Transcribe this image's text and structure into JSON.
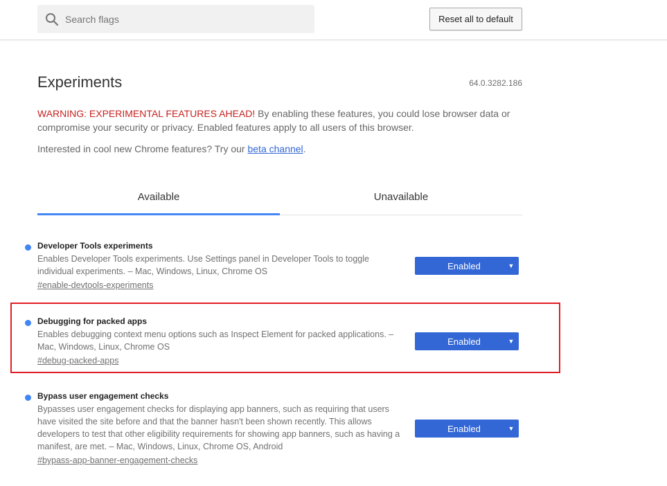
{
  "header": {
    "search_placeholder": "Search flags",
    "reset_label": "Reset all to default"
  },
  "page": {
    "title": "Experiments",
    "version": "64.0.3282.186",
    "warning_red": "WARNING: EXPERIMENTAL FEATURES AHEAD!",
    "warning_text": " By enabling these features, you could lose browser data or compromise your security or privacy. Enabled features apply to all users of this browser.",
    "interest_text": "Interested in cool new Chrome features? Try our ",
    "interest_link": "beta channel",
    "interest_end": "."
  },
  "tabs": [
    {
      "label": "Available",
      "active": true
    },
    {
      "label": "Unavailable",
      "active": false
    }
  ],
  "experiments": [
    {
      "name": "Developer Tools experiments",
      "description": "Enables Developer Tools experiments. Use Settings panel in Developer Tools to toggle individual experiments. – Mac, Windows, Linux, Chrome OS",
      "link": "#enable-devtools-experiments",
      "value": "Enabled"
    },
    {
      "name": "Debugging for packed apps",
      "description": "Enables debugging context menu options such as Inspect Element for packed applications. – Mac, Windows, Linux, Chrome OS",
      "link": "#debug-packed-apps",
      "value": "Enabled"
    },
    {
      "name": "Bypass user engagement checks",
      "description": "Bypasses user engagement checks for displaying app banners, such as requiring that users have visited the site before and that the banner hasn't been shown recently. This allows developers to test that other eligibility requirements for showing app banners, such as having a manifest, are met. – Mac, Windows, Linux, Chrome OS, Android",
      "link": "#bypass-app-banner-engagement-checks",
      "value": "Enabled"
    }
  ],
  "colors": {
    "accent": "#4285f4",
    "select_bg": "#3367d6",
    "warning": "#c5221f",
    "highlight_border": "#e01c24"
  },
  "icons": {
    "search": "search-icon",
    "dropdown": "dropdown-arrow-icon"
  }
}
